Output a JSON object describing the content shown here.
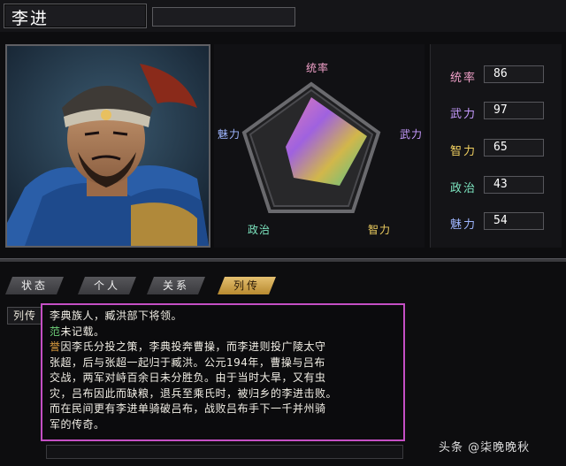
{
  "header": {
    "name": "李进",
    "secondary": ""
  },
  "radar": {
    "labels": [
      "统率",
      "武力",
      "智力",
      "政治",
      "魅力"
    ]
  },
  "stats": [
    {
      "label": "统率",
      "value": "86",
      "color": "#f0a0c8"
    },
    {
      "label": "武力",
      "value": "97",
      "color": "#c79bff"
    },
    {
      "label": "智力",
      "value": "65",
      "color": "#f0d060"
    },
    {
      "label": "政治",
      "value": "43",
      "color": "#7de6c0"
    },
    {
      "label": "魅力",
      "value": "54",
      "color": "#9fb6ff"
    }
  ],
  "tabs": [
    "状态",
    "个人",
    "关系",
    "列传"
  ],
  "active_tab": "列传",
  "bio": {
    "label": "列传",
    "lines": [
      "李典族人，臧洪部下将领。",
      "未记载。",
      "因李氏分投之策，李典投奔曹操，而李进则投广陵太守",
      "张超，后与张超一起归于臧洪。公元194年，曹操与吕布",
      "交战，两军对峙百余日未分胜负。由于当时大旱，又有虫",
      "灾，吕布因此而缺粮，退兵至乘氏时，被归乡的李进击败。",
      "而在民间更有李进单骑破吕布，战败吕布手下一千并州骑",
      "军的传奇。"
    ],
    "markers": {
      "line2": "范",
      "line3": "誉"
    }
  },
  "watermark": "头条 @柒晚晚秋"
}
